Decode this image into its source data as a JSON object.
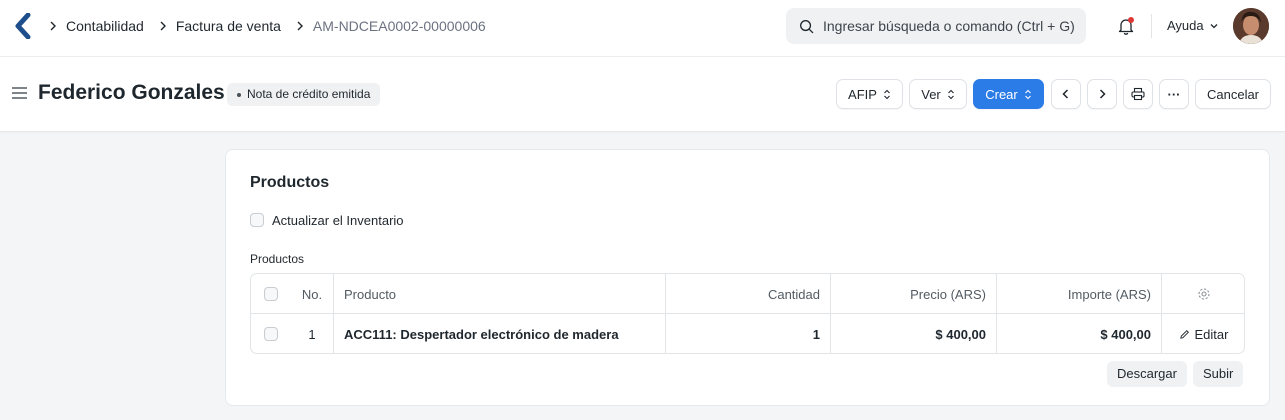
{
  "breadcrumbs": [
    "Contabilidad",
    "Factura de venta",
    "AM-NDCEA0002-00000006"
  ],
  "search": {
    "placeholder": "Ingresar búsqueda o comando (Ctrl + G)"
  },
  "navbar": {
    "help_label": "Ayuda"
  },
  "page": {
    "title": "Federico Gonzales",
    "status": "Nota de crédito emitida",
    "actions": {
      "afip": "AFIP",
      "ver": "Ver",
      "crear": "Crear",
      "cancelar": "Cancelar",
      "more": "···"
    }
  },
  "section": {
    "title": "Productos",
    "update_stock_label": "Actualizar el Inventario",
    "items_label": "Productos"
  },
  "table": {
    "columns": [
      "No.",
      "Producto",
      "Cantidad",
      "Precio (ARS)",
      "Importe (ARS)"
    ],
    "rows": [
      {
        "no": "1",
        "product": "ACC111: Despertador electrónico de madera",
        "qty": "1",
        "rate": "$ 400,00",
        "amount": "$ 400,00",
        "edit": "Editar"
      }
    ],
    "download_label": "Descargar",
    "upload_label": "Subir"
  },
  "colors": {
    "primary": "#2b7ce6",
    "notification": "#e03636"
  }
}
